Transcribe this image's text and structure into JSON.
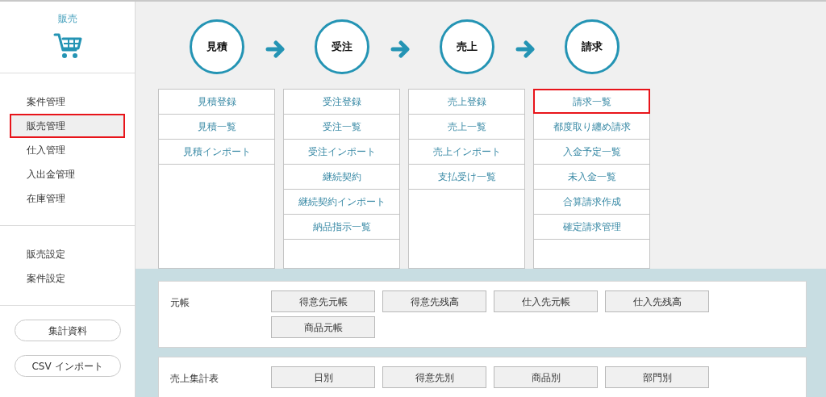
{
  "sidebar": {
    "title": "販売",
    "nav_items": [
      {
        "label": "案件管理",
        "selected": false
      },
      {
        "label": "販売管理",
        "selected": true
      },
      {
        "label": "仕入管理",
        "selected": false
      },
      {
        "label": "入出金管理",
        "selected": false
      },
      {
        "label": "在庫管理",
        "selected": false
      }
    ],
    "settings_items": [
      {
        "label": "販売設定",
        "selected": false
      },
      {
        "label": "案件設定",
        "selected": false
      }
    ],
    "buttons": [
      "集計資料",
      "CSV インポート"
    ]
  },
  "flow": [
    {
      "step": "見積",
      "links": [
        {
          "label": "見積登録",
          "selected": false
        },
        {
          "label": "見積一覧",
          "selected": false
        },
        {
          "label": "見積インポート",
          "selected": false
        }
      ]
    },
    {
      "step": "受注",
      "links": [
        {
          "label": "受注登録",
          "selected": false
        },
        {
          "label": "受注一覧",
          "selected": false
        },
        {
          "label": "受注インポート",
          "selected": false
        },
        {
          "label": "継続契約",
          "selected": false
        },
        {
          "label": "継続契約インポート",
          "selected": false
        },
        {
          "label": "納品指示一覧",
          "selected": false
        }
      ]
    },
    {
      "step": "売上",
      "links": [
        {
          "label": "売上登録",
          "selected": false
        },
        {
          "label": "売上一覧",
          "selected": false
        },
        {
          "label": "売上インポート",
          "selected": false
        },
        {
          "label": "支払受け一覧",
          "selected": false
        }
      ]
    },
    {
      "step": "請求",
      "links": [
        {
          "label": "請求一覧",
          "selected": true
        },
        {
          "label": "都度取り纏め請求",
          "selected": false
        },
        {
          "label": "入金予定一覧",
          "selected": false
        },
        {
          "label": "未入金一覧",
          "selected": false
        },
        {
          "label": "合算請求作成",
          "selected": false
        },
        {
          "label": "確定請求管理",
          "selected": false
        }
      ]
    }
  ],
  "reports": [
    {
      "title": "元帳",
      "buttons": [
        "得意先元帳",
        "得意先残高",
        "仕入先元帳",
        "仕入先残高",
        "商品元帳"
      ]
    },
    {
      "title": "売上集計表",
      "buttons": [
        "日別",
        "得意先別",
        "商品別",
        "部門別"
      ]
    }
  ]
}
